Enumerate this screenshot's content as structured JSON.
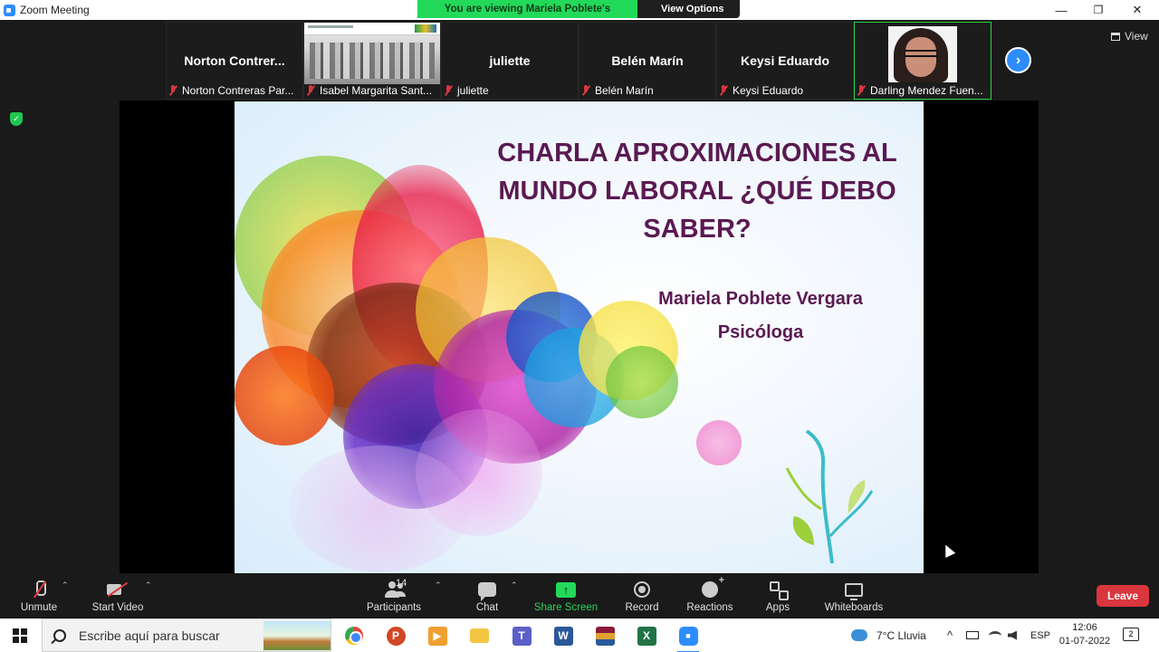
{
  "window": {
    "title": "Zoom Meeting",
    "minimize_glyph": "—",
    "restore_glyph": "❐",
    "close_glyph": "✕"
  },
  "banner": {
    "viewing_text": "You are viewing Mariela Poblete's screen",
    "view_options_label": "View Options",
    "view_options_caret": "⌄"
  },
  "participants": [
    {
      "display": "Norton  Contrer...",
      "label": "Norton Contreras Par...",
      "type": "name"
    },
    {
      "display": "",
      "label": "Isabel Margarita Sant...",
      "type": "video-room"
    },
    {
      "display": "juliette",
      "label": "juliette",
      "type": "name"
    },
    {
      "display": "Belén Marín",
      "label": "Belén Marín",
      "type": "name"
    },
    {
      "display": "Keysi Eduardo",
      "label": "Keysi Eduardo",
      "type": "name"
    },
    {
      "display": "",
      "label": "Darling Mendez Fuen...",
      "type": "video-face"
    }
  ],
  "strip": {
    "next_glyph": "›",
    "view_label": "View"
  },
  "security_glyph": "✓",
  "slide": {
    "title_lines": [
      "CHARLA APROXIMACIONES AL",
      "MUNDO LABORAL ¿QUÉ DEBO",
      "SABER?"
    ],
    "presenter": "Mariela Poblete Vergara",
    "role": "Psicóloga",
    "title_color": "#5a1a52"
  },
  "toolbar": {
    "unmute": "Unmute",
    "start_video": "Start Video",
    "participants": "Participants",
    "participants_count": "14",
    "chat": "Chat",
    "share_screen": "Share Screen",
    "share_glyph": "↑",
    "record": "Record",
    "reactions": "Reactions",
    "apps": "Apps",
    "whiteboards": "Whiteboards",
    "leave": "Leave",
    "caret": "⌃",
    "leave_color": "#d9363e",
    "accent_green": "#23d959"
  },
  "taskbar": {
    "search_placeholder": "Escribe aquí para buscar",
    "apps": [
      "chrome",
      "powerpoint",
      "media",
      "file-explorer",
      "teams",
      "word",
      "winrar",
      "excel",
      "zoom"
    ],
    "powerpoint_glyph": "P",
    "media_glyph": "▶",
    "teams_glyph": "T",
    "word_glyph": "W",
    "excel_glyph": "X",
    "zoom_glyph": "■",
    "weather": "7°C  Lluvia",
    "language": "ESP",
    "time": "12:06",
    "date": "01-07-2022",
    "notifications": "2",
    "tray_chevron": "^"
  }
}
